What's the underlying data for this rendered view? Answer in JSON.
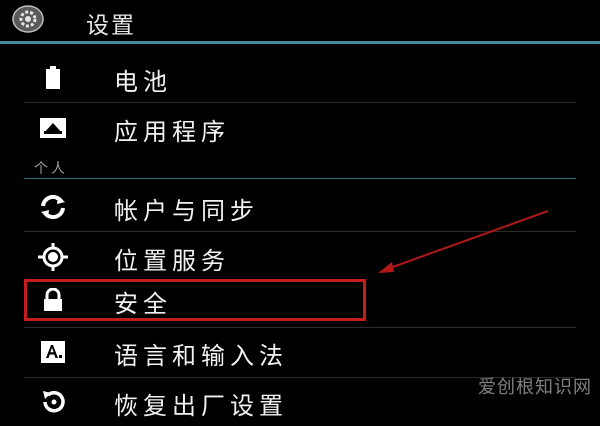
{
  "header": {
    "title": "设置",
    "icon": "gear-icon"
  },
  "items_top": [
    {
      "label": "电池",
      "icon": "battery-icon"
    },
    {
      "label": "应用程序",
      "icon": "apps-icon"
    }
  ],
  "section": {
    "label": "个人"
  },
  "items_personal": [
    {
      "label": "帐户与同步",
      "icon": "sync-icon"
    },
    {
      "label": "位置服务",
      "icon": "location-icon"
    },
    {
      "label": "安全",
      "icon": "lock-icon"
    },
    {
      "label": "语言和输入法",
      "icon": "keyboard-icon"
    },
    {
      "label": "恢复出厂设置",
      "icon": "restore-icon"
    }
  ],
  "colors": {
    "accent": "#4a8a9c",
    "highlight": "#c41d1d"
  },
  "watermark": "爱创根知识网"
}
